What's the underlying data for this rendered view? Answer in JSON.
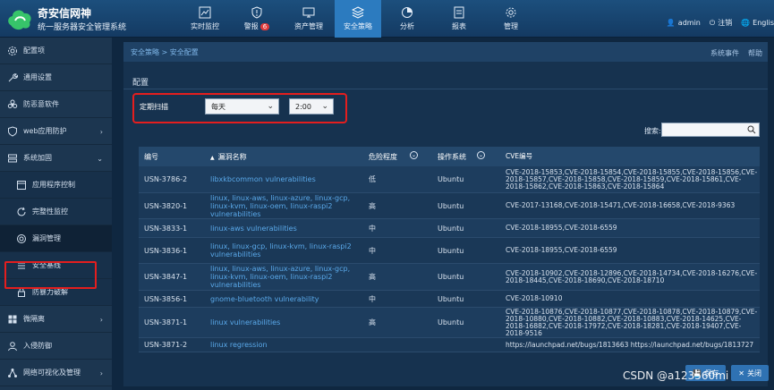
{
  "brand": {
    "title": "奇安信网神",
    "subtitle": "统一服务器安全管理系统"
  },
  "nav": [
    {
      "label": "实时监控",
      "icon": "chart-icon"
    },
    {
      "label": "警报",
      "icon": "shield-alert-icon",
      "badge": "6"
    },
    {
      "label": "资产管理",
      "icon": "monitor-icon"
    },
    {
      "label": "安全策略",
      "icon": "layers-icon",
      "active": true
    },
    {
      "label": "分析",
      "icon": "pie-icon"
    },
    {
      "label": "报表",
      "icon": "report-icon"
    },
    {
      "label": "管理",
      "icon": "gear-icon"
    }
  ],
  "user": {
    "name": "admin",
    "logout": "注销",
    "lang": "Englis"
  },
  "sidebar": {
    "items": [
      {
        "label": "配置项",
        "icon": "gear-icon"
      },
      {
        "label": "通用设置",
        "icon": "wrench-icon"
      },
      {
        "label": "防恶意软件",
        "icon": "biohazard-icon"
      },
      {
        "label": "web应用防护",
        "icon": "shield-icon",
        "chev": "›"
      },
      {
        "label": "系统加固",
        "icon": "server-icon",
        "chev": "⌄"
      },
      {
        "label": "应用程序控制",
        "icon": "app-icon",
        "sub": true
      },
      {
        "label": "完整性监控",
        "icon": "refresh-icon",
        "sub": true
      },
      {
        "label": "漏洞管理",
        "icon": "vuln-icon",
        "sub": true,
        "selected": true
      },
      {
        "label": "安全基线",
        "icon": "baseline-icon",
        "sub": true
      },
      {
        "label": "防暴力破解",
        "icon": "lock-icon",
        "sub": true
      },
      {
        "label": "微隔离",
        "icon": "grid-icon",
        "chev": "›"
      },
      {
        "label": "入侵防御",
        "icon": "user-icon"
      },
      {
        "label": "网络可视化及管理",
        "icon": "network-icon",
        "chev": "›"
      }
    ]
  },
  "breadcrumb": "安全策略 > 安全配置",
  "events": "系统事件",
  "help": "帮助",
  "config_title": "配置",
  "scan": {
    "label": "定期扫描",
    "frequency": "每天",
    "time": "2:00"
  },
  "search_label": "搜索:",
  "table": {
    "headers": [
      "编号",
      "漏洞名称",
      "危险程度",
      "操作系统",
      "CVE编号"
    ],
    "rows": [
      {
        "id": "USN-3786-2",
        "name": "libxkbcommon vulnerabilities",
        "level": "低",
        "os": "Ubuntu",
        "cve": "CVE-2018-15853,CVE-2018-15854,CVE-2018-15855,CVE-2018-15856,CVE-2018-15857,CVE-2018-15858,CVE-2018-15859,CVE-2018-15861,CVE-2018-15862,CVE-2018-15863,CVE-2018-15864"
      },
      {
        "id": "USN-3820-1",
        "name": "linux, linux-aws, linux-azure, linux-gcp, linux-kvm, linux-oem, linux-raspi2 vulnerabilities",
        "level": "高",
        "os": "Ubuntu",
        "cve": "CVE-2017-13168,CVE-2018-15471,CVE-2018-16658,CVE-2018-9363"
      },
      {
        "id": "USN-3833-1",
        "name": "linux-aws vulnerabilities",
        "level": "中",
        "os": "Ubuntu",
        "cve": "CVE-2018-18955,CVE-2018-6559"
      },
      {
        "id": "USN-3836-1",
        "name": "linux, linux-gcp, linux-kvm, linux-raspi2 vulnerabilities",
        "level": "中",
        "os": "Ubuntu",
        "cve": "CVE-2018-18955,CVE-2018-6559"
      },
      {
        "id": "USN-3847-1",
        "name": "linux, linux-aws, linux-azure, linux-gcp, linux-kvm, linux-oem, linux-raspi2 vulnerabilities",
        "level": "高",
        "os": "Ubuntu",
        "cve": "CVE-2018-10902,CVE-2018-12896,CVE-2018-14734,CVE-2018-16276,CVE-2018-18445,CVE-2018-18690,CVE-2018-18710"
      },
      {
        "id": "USN-3856-1",
        "name": "gnome-bluetooth vulnerability",
        "level": "中",
        "os": "Ubuntu",
        "cve": "CVE-2018-10910"
      },
      {
        "id": "USN-3871-1",
        "name": "linux vulnerabilities",
        "level": "高",
        "os": "Ubuntu",
        "cve": "CVE-2018-10876,CVE-2018-10877,CVE-2018-10878,CVE-2018-10879,CVE-2018-10880,CVE-2018-10882,CVE-2018-10883,CVE-2018-14625,CVE-2018-16882,CVE-2018-17972,CVE-2018-18281,CVE-2018-19407,CVE-2018-9516"
      },
      {
        "id": "USN-3871-2",
        "name": "linux regression",
        "level": "",
        "os": "",
        "cve": "https://launchpad.net/bugs/1813663 https://launchpad.net/bugs/1813727"
      }
    ]
  },
  "buttons": {
    "save": "保存",
    "close": "关闭"
  },
  "watermark": "CSDN @a123560mi"
}
